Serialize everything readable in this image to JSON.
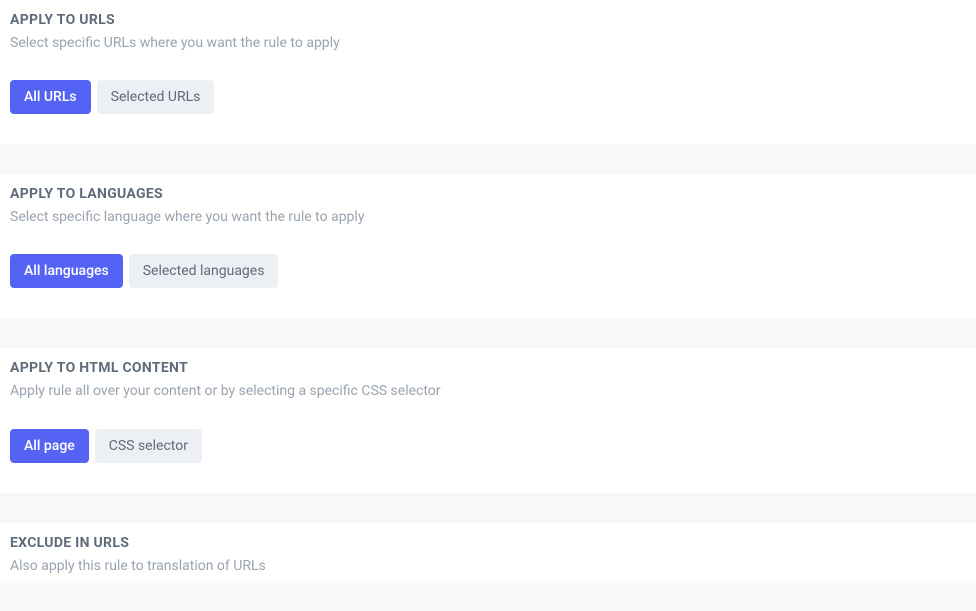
{
  "sections": {
    "urls": {
      "title": "APPLY TO URLS",
      "description": "Select specific URLs where you want the rule to apply",
      "option_all": "All URLs",
      "option_selected": "Selected URLs"
    },
    "languages": {
      "title": "APPLY TO LANGUAGES",
      "description": "Select specific language where you want the rule to apply",
      "option_all": "All languages",
      "option_selected": "Selected languages"
    },
    "html_content": {
      "title": "APPLY TO HTML CONTENT",
      "description": "Apply rule all over your content or by selecting a specific CSS selector",
      "option_all": "All page",
      "option_selected": "CSS selector"
    },
    "exclude_urls": {
      "title": "EXCLUDE IN URLS",
      "description": "Also apply this rule to translation of URLs"
    }
  }
}
